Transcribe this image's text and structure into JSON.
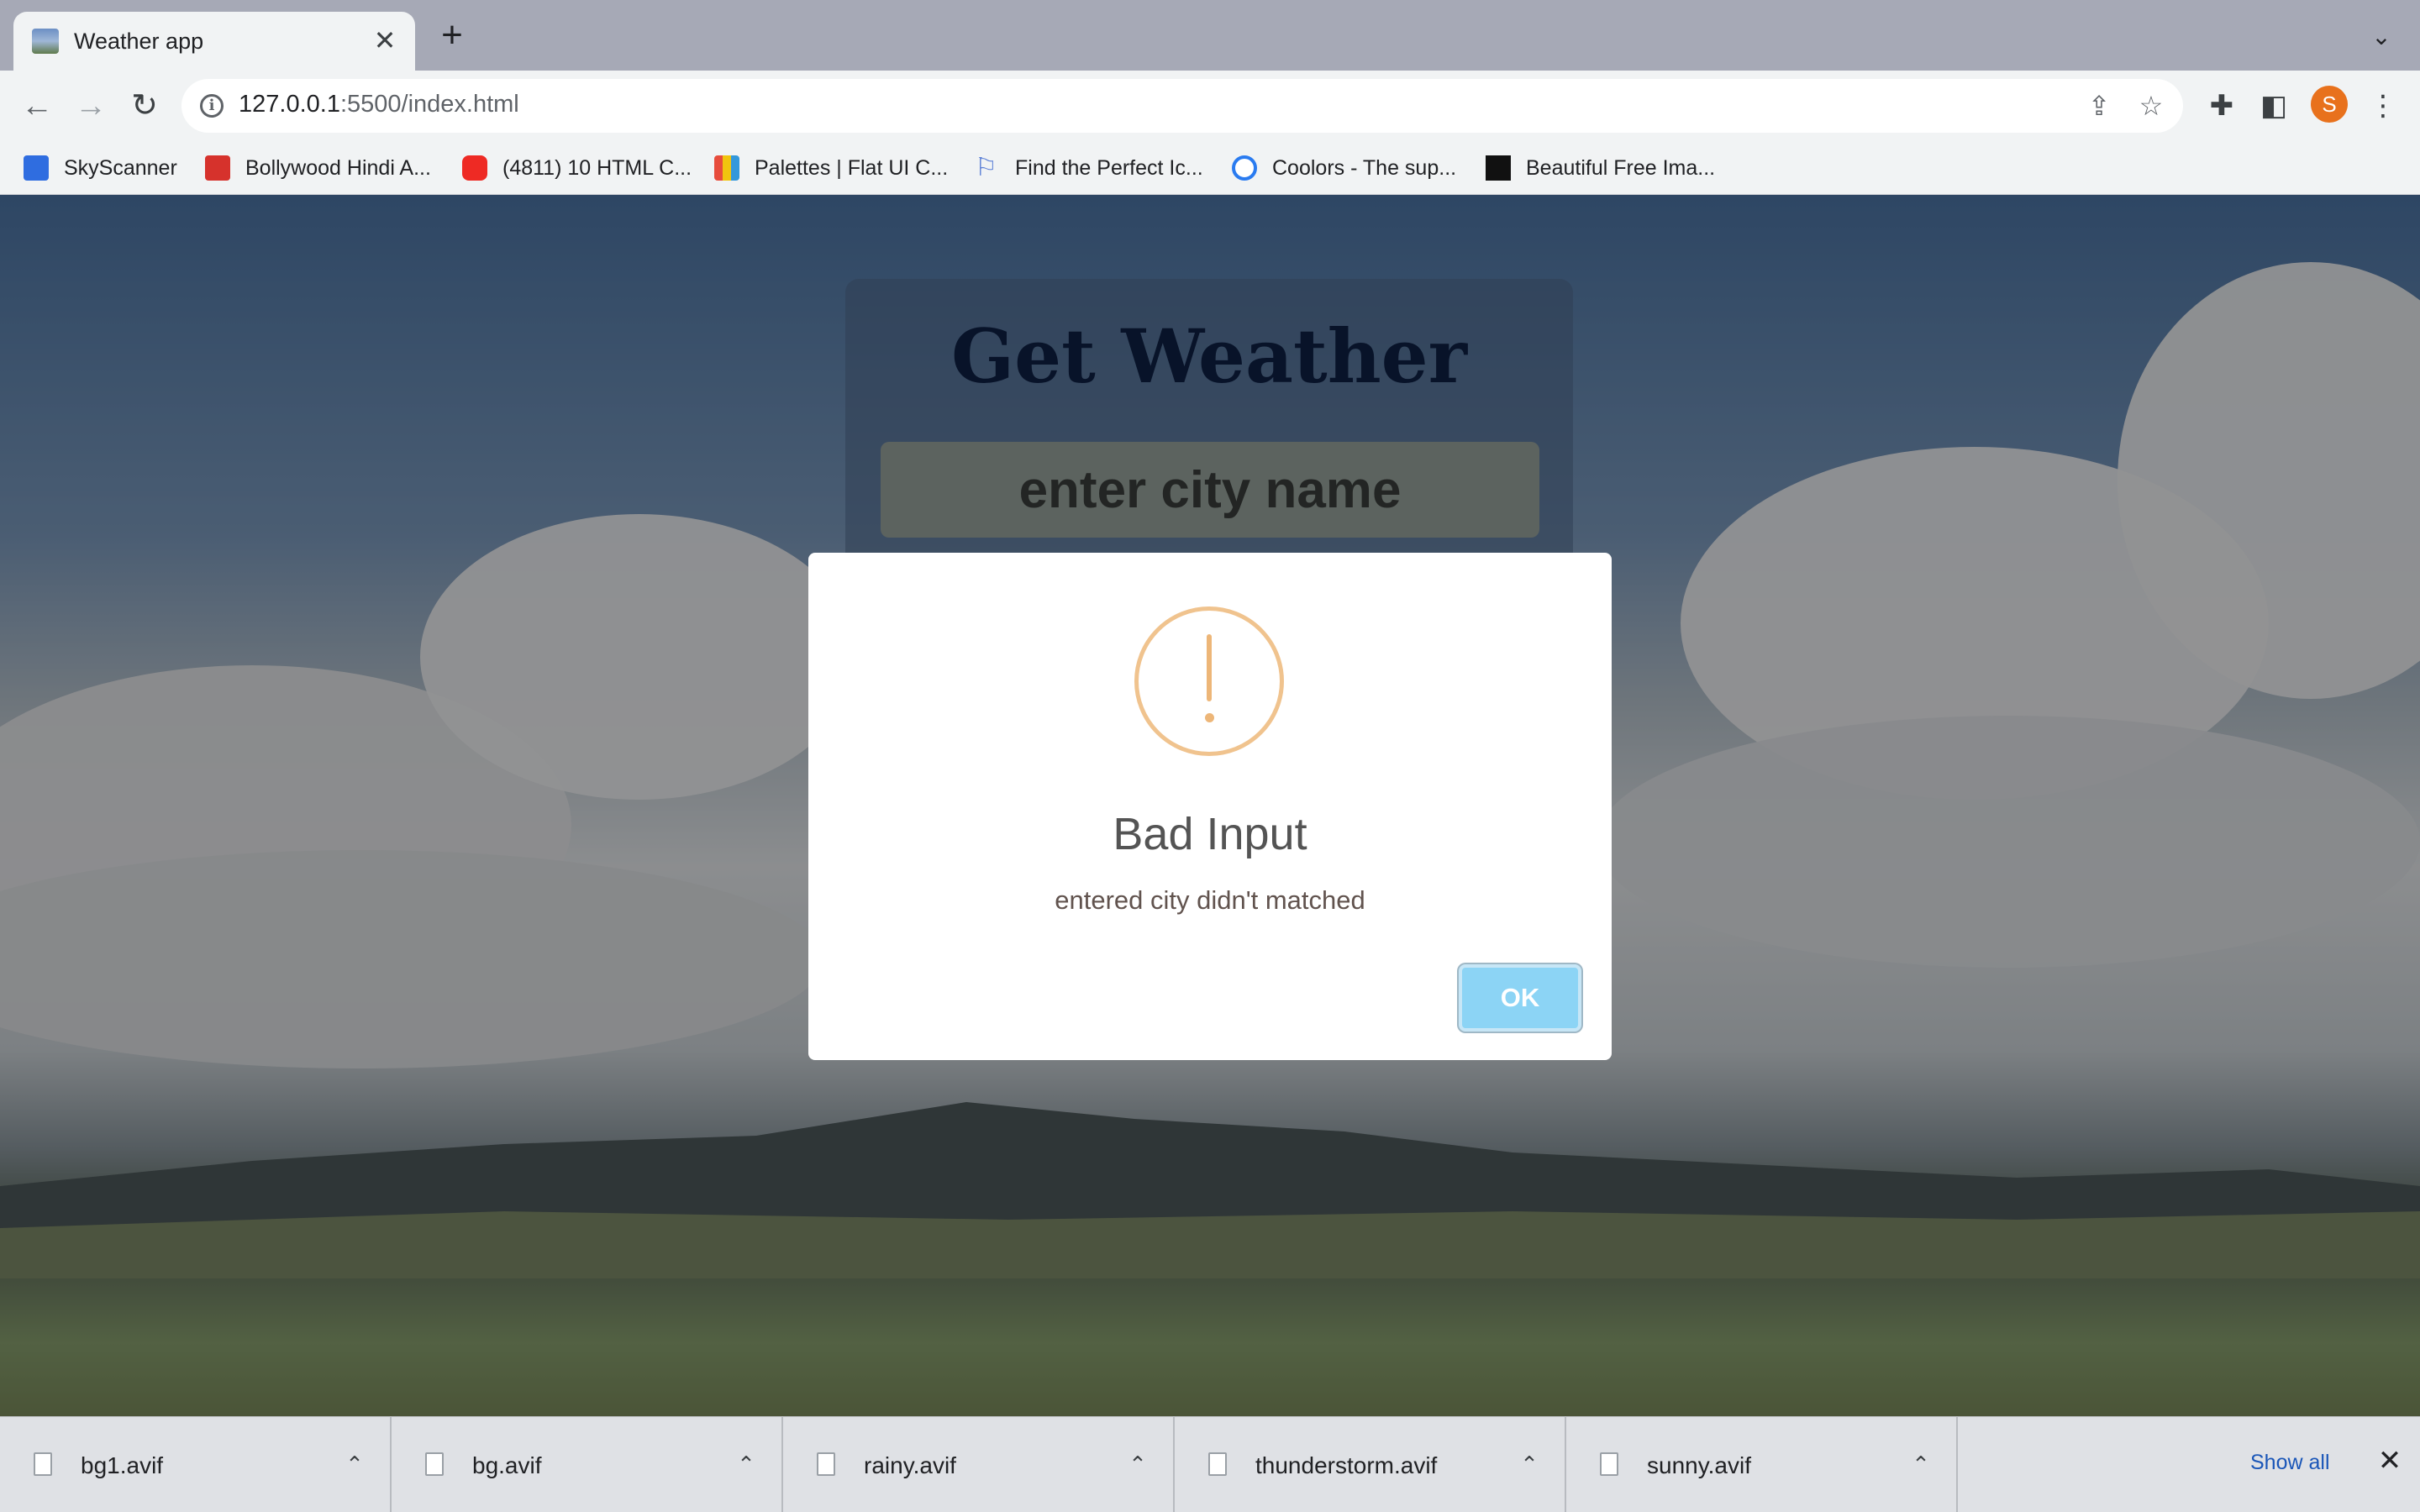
{
  "browser": {
    "tab": {
      "title": "Weather app",
      "close": "✕"
    },
    "new_tab": "+",
    "tab_search": "⌄",
    "url_host": "127.0.0.1",
    "url_rest": ":5500/index.html",
    "profile_initial": "S",
    "icons": {
      "back": "arrow-left-icon",
      "forward": "arrow-right-icon",
      "reload": "reload-icon",
      "share": "share-icon",
      "star": "star-icon",
      "extensions": "puzzle-icon",
      "side_panel": "side-panel-icon",
      "menu": "kebab-menu-icon"
    }
  },
  "bookmarks": [
    {
      "label": "SkyScanner",
      "color": "#2f6de0"
    },
    {
      "label": "Bollywood Hindi A...",
      "color": "#d6322c"
    },
    {
      "label": "(4811) 10 HTML C...",
      "color": "#ee2a24"
    },
    {
      "label": "Palettes | Flat UI C...",
      "color": "#7bb661"
    },
    {
      "label": "Find the Perfect Ic...",
      "color": "#5b7fd6"
    },
    {
      "label": "Coolors - The sup...",
      "color": "#2a7bf0"
    },
    {
      "label": "Beautiful Free Ima...",
      "color": "#111111"
    }
  ],
  "app": {
    "title": "Get Weather",
    "city_placeholder": "enter city name"
  },
  "modal": {
    "icon": "warning-icon",
    "title": "Bad Input",
    "text": "entered city didn't matched",
    "ok_label": "OK",
    "accent_color": "#f0c38e",
    "button_color": "#8cd4f5"
  },
  "downloads": {
    "items": [
      {
        "name": "bg1.avif"
      },
      {
        "name": "bg.avif"
      },
      {
        "name": "rainy.avif"
      },
      {
        "name": "thunderstorm.avif"
      },
      {
        "name": "sunny.avif"
      }
    ],
    "show_all": "Show all",
    "close": "✕"
  }
}
